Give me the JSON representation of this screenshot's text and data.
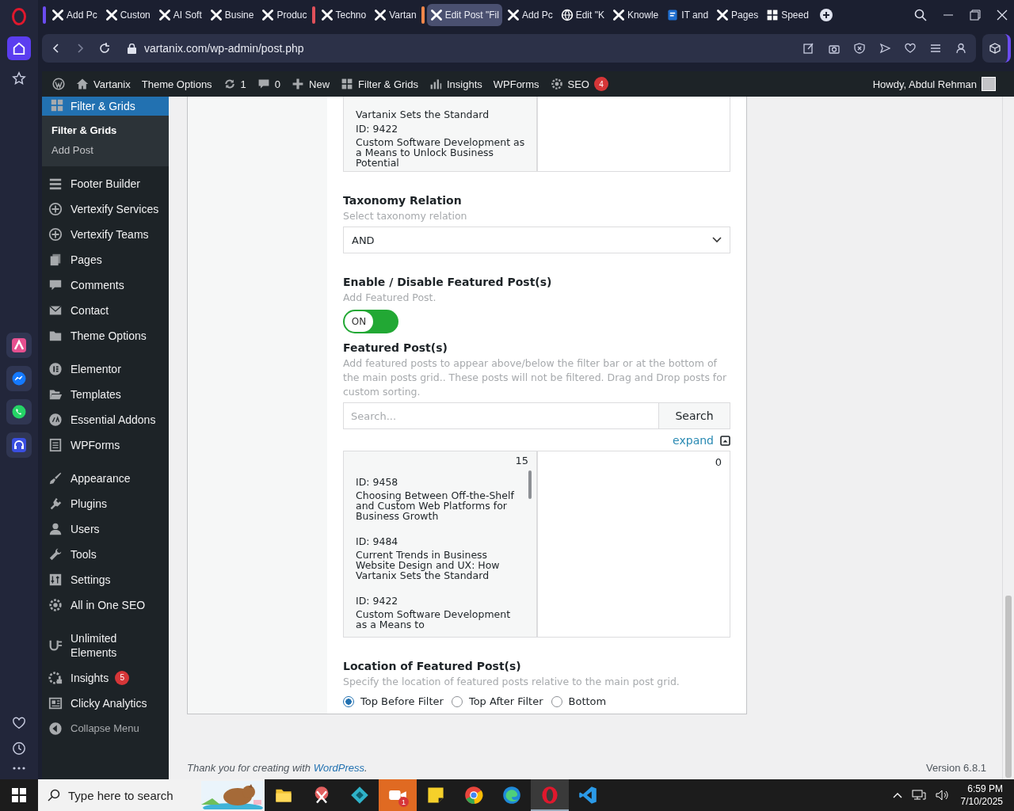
{
  "browser": {
    "tabs": [
      {
        "label": "Add Pc",
        "kind": "x",
        "selected": false,
        "color": "#6b4cf0"
      },
      {
        "label": "Custon",
        "kind": "x",
        "selected": false
      },
      {
        "label": "AI Soft",
        "kind": "x",
        "selected": false
      },
      {
        "label": "Busine",
        "kind": "x",
        "selected": false
      },
      {
        "label": "Produc",
        "kind": "x",
        "selected": false
      },
      {
        "label": "Techno",
        "kind": "x",
        "selected": false,
        "color": "#e0505a"
      },
      {
        "label": "Vartan",
        "kind": "x",
        "selected": false
      },
      {
        "label": "Edit Post \"Fil",
        "kind": "x",
        "selected": true,
        "color": "#f0874a"
      },
      {
        "label": "Add Pc",
        "kind": "x",
        "selected": false
      },
      {
        "label": "Edit \"K",
        "kind": "globe",
        "selected": false
      },
      {
        "label": "Knowle",
        "kind": "x",
        "selected": false
      },
      {
        "label": "IT and",
        "kind": "doc",
        "selected": false
      },
      {
        "label": "Pages",
        "kind": "x",
        "selected": false
      },
      {
        "label": "Speed",
        "kind": "grid",
        "selected": false
      }
    ],
    "address": "vartanix.com/wp-admin/post.php",
    "rail_apps": [
      {
        "kind": "arc"
      },
      {
        "kind": "messenger"
      },
      {
        "kind": "whatsapp"
      },
      {
        "kind": "headphones"
      }
    ]
  },
  "admin_bar": {
    "items": [
      {
        "kind": "wp"
      },
      {
        "kind": "home",
        "label": "Vartanix"
      },
      {
        "label": "Theme Options"
      },
      {
        "kind": "refresh",
        "label": "1"
      },
      {
        "kind": "bubble",
        "label": "0"
      },
      {
        "kind": "plus",
        "label": "New"
      },
      {
        "kind": "grid",
        "label": "Filter & Grids"
      },
      {
        "kind": "chart",
        "label": "Insights"
      },
      {
        "label": "WPForms"
      },
      {
        "kind": "gear",
        "label": "SEO",
        "badge": "4"
      }
    ],
    "greeting": "Howdy, Abdul Rehman"
  },
  "sidebar": {
    "current": {
      "label": "Filter & Grids",
      "submenu": [
        {
          "label": "Filter & Grids",
          "selected": true
        },
        {
          "label": "Add Post",
          "selected": false
        }
      ]
    },
    "groups": [
      [
        {
          "label": "Footer Builder",
          "kind": "bars"
        },
        {
          "label": "Vertexify Services",
          "kind": "plus-circle"
        },
        {
          "label": "Vertexify Teams",
          "kind": "plus-circle"
        },
        {
          "label": "Pages",
          "kind": "pages"
        },
        {
          "label": "Comments",
          "kind": "bubble"
        },
        {
          "label": "Contact",
          "kind": "envelope"
        },
        {
          "label": "Theme Options",
          "kind": "folder"
        }
      ],
      [
        {
          "label": "Elementor",
          "kind": "e-circle"
        },
        {
          "label": "Templates",
          "kind": "folder-open"
        },
        {
          "label": "Essential Addons",
          "kind": "circle"
        },
        {
          "label": "WPForms",
          "kind": "form"
        }
      ],
      [
        {
          "label": "Appearance",
          "kind": "brush"
        },
        {
          "label": "Plugins",
          "kind": "plug"
        },
        {
          "label": "Users",
          "kind": "user"
        },
        {
          "label": "Tools",
          "kind": "wrench"
        },
        {
          "label": "Settings",
          "kind": "sliders"
        },
        {
          "label": "All in One SEO",
          "kind": "gear"
        }
      ],
      [
        {
          "label": "Unlimited Elements",
          "kind": "bracket"
        },
        {
          "label": "Insights",
          "kind": "insights",
          "badge": "5"
        },
        {
          "label": "Clicky Analytics",
          "kind": "news"
        },
        {
          "label": "Collapse Menu",
          "kind": "collapse"
        }
      ]
    ]
  },
  "top_list": {
    "items": [
      {
        "title": "Vartanix Sets the Standard"
      },
      {
        "id": "ID: 9422",
        "title": "Custom Software Development as a Means to Unlock Business Potential"
      }
    ]
  },
  "taxonomy": {
    "title": "Taxonomy Relation",
    "description": "Select taxonomy relation",
    "value": "AND"
  },
  "featured_toggle": {
    "title": "Enable / Disable Featured Post(s)",
    "description": "Add Featured Post.",
    "on": true,
    "label": "ON"
  },
  "featured_posts": {
    "title": "Featured Post(s)",
    "description": "Add featured posts to appear above/below the filter bar or at the bottom of the main posts grid.. These posts will not be filtered. Drag and Drop posts for custom sorting.",
    "search": {
      "placeholder": "Search...",
      "button": "Search"
    },
    "expand": "expand",
    "available_count": "15",
    "selected_count": "0",
    "available": [
      {
        "id": "ID: 9458",
        "title": "Choosing Between Off-the-Shelf and Custom Web Platforms for Business Growth"
      },
      {
        "id": "ID: 9484",
        "title": "Current Trends in Business Website Design and UX: How Vartanix Sets the Standard"
      },
      {
        "id": "ID: 9422",
        "title": "Custom Software Development as a Means to"
      }
    ]
  },
  "location": {
    "title": "Location of Featured Post(s)",
    "description": "Specify the location of featured posts relative to the main post grid.",
    "options": [
      {
        "label": "Top Before Filter",
        "selected": true
      },
      {
        "label": "Top After Filter",
        "selected": false
      },
      {
        "label": "Bottom",
        "selected": false
      }
    ]
  },
  "footer": {
    "before": "Thank you for creating with ",
    "link": "WordPress",
    "after": ".",
    "version": "Version 6.8.1"
  },
  "taskbar": {
    "search_placeholder": "Type here to search",
    "apps": [
      {
        "kind": "explorer",
        "selected": false
      },
      {
        "kind": "snip",
        "selected": false
      },
      {
        "kind": "gem",
        "selected": false
      },
      {
        "kind": "zoom",
        "selected": false,
        "badge": "1"
      },
      {
        "kind": "sticky",
        "selected": false
      },
      {
        "kind": "chrome",
        "selected": false
      },
      {
        "kind": "edge",
        "selected": false
      },
      {
        "kind": "opera",
        "selected": true
      },
      {
        "kind": "vscode",
        "selected": false
      }
    ],
    "time": "6:59 PM",
    "date": "7/10/2025"
  }
}
